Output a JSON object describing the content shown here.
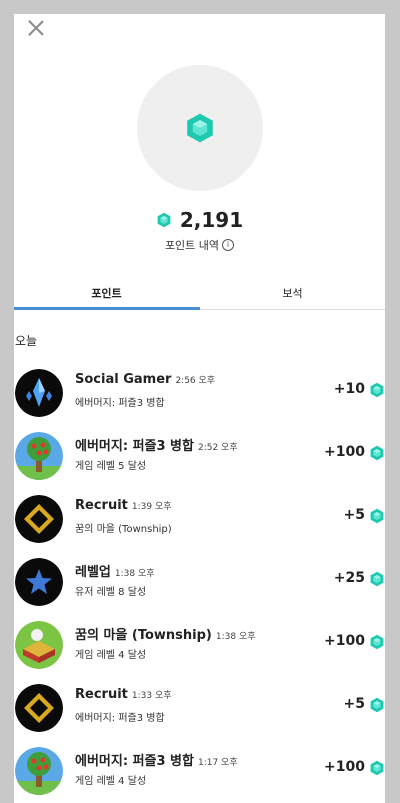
{
  "balance": {
    "value": "2,191",
    "history_label": "포인트 내역",
    "info_symbol": "i"
  },
  "tabs": {
    "points": "포인트",
    "gems": "보석"
  },
  "section": {
    "today": "오늘"
  },
  "rows": [
    {
      "title": "Social Gamer",
      "time": "2:56 오후",
      "subtitle": "에버머지: 퍼즐3 병합",
      "amount": "+10",
      "avatar": "crystal-icon"
    },
    {
      "title": "에버머지: 퍼즐3 병합",
      "time": "2:52 오후",
      "subtitle": "게임 레벨 5 달성",
      "amount": "+100",
      "avatar": "tree-icon"
    },
    {
      "title": "Recruit",
      "time": "1:39 오후",
      "subtitle": "꿈의 마을 (Township)",
      "amount": "+5",
      "avatar": "badge-icon"
    },
    {
      "title": "레벨업",
      "time": "1:38 오후",
      "subtitle": "유저 레벨 8 달성",
      "amount": "+25",
      "avatar": "star-icon"
    },
    {
      "title": "꿈의 마을 (Township)",
      "time": "1:38 오후",
      "subtitle": "게임 레벨 4 달성",
      "amount": "+100",
      "avatar": "township-icon"
    },
    {
      "title": "Recruit",
      "time": "1:33 오후",
      "subtitle": "에버머지: 퍼즐3 병합",
      "amount": "+5",
      "avatar": "badge-icon"
    },
    {
      "title": "에버머지: 퍼즐3 병합",
      "time": "1:17 오후",
      "subtitle": "게임 레벨 4 달성",
      "amount": "+100",
      "avatar": "tree-icon"
    }
  ],
  "colors": {
    "gem": "#1fc8b0",
    "tab_active": "#4a8ed8",
    "backdrop": "#c8c8c8"
  }
}
